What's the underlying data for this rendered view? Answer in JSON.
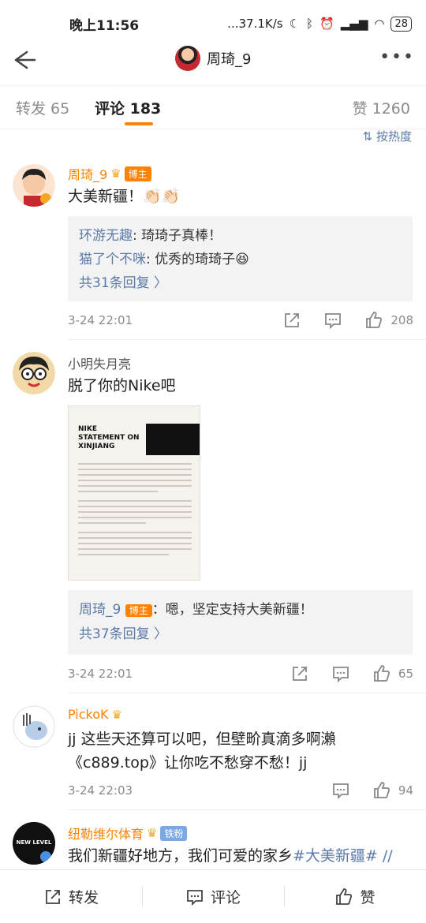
{
  "status": {
    "time": "晚上11:56",
    "speed": "...37.1K/s",
    "battery": "28"
  },
  "nav": {
    "title": "周琦_9"
  },
  "tabs": [
    {
      "label": "转发 65"
    },
    {
      "label": "评论 183"
    },
    {
      "label": "赞 1260"
    }
  ],
  "sort_label": "按热度",
  "comments": [
    {
      "name": "周琦_9",
      "badge": "博主",
      "text": "大美新疆！👏🏻👏🏻",
      "replies": [
        {
          "name": "环游无趣",
          "text": ": 琦琦子真棒！"
        },
        {
          "name": "猫了个不咪",
          "text": ": 优秀的琦琦子😆"
        }
      ],
      "more_replies": "共31条回复 〉",
      "time": "3-24 22:01",
      "likes": "208"
    },
    {
      "name": "小明失月亮",
      "text": "脱了你的Nike吧",
      "image_heading": "NIKE STATEMENT ON XINJIANG",
      "replies": [
        {
          "name": "周琦_9",
          "badge": "博主",
          "text": "：嗯，坚定支持大美新疆！"
        }
      ],
      "more_replies": "共37条回复 〉",
      "time": "3-24 22:01",
      "likes": "65"
    },
    {
      "name": "PickoK",
      "text": "jj 这些天还算可以吧，但壁畍真滴多啊瀨《c889.top》让你吃不愁穿不愁！jj",
      "time": "3-24 22:03",
      "likes": "94"
    },
    {
      "name": "纽勒维尔体育",
      "badge": "铁粉",
      "text_plain": "我们新疆好地方，我们可爱的家乡",
      "text_tag": "#大美新疆#",
      "text_tail": " //"
    }
  ],
  "bottom": {
    "repost": "转发",
    "comment": "评论",
    "like": "赞"
  },
  "colors": {
    "accent": "#ff8200",
    "link": "#5b7aa8",
    "badge_blue": "#7aa7e6"
  }
}
